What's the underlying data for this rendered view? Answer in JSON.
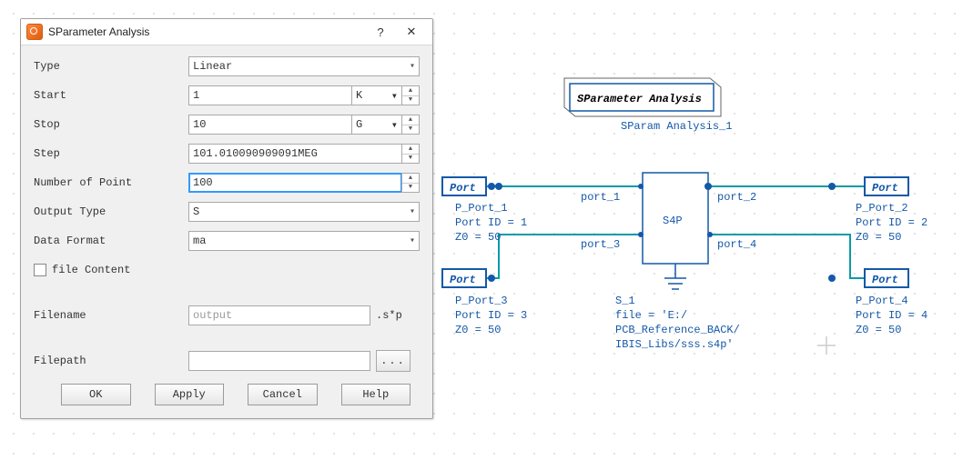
{
  "dialog": {
    "title": "SParameter Analysis",
    "help": "?",
    "close": "✕",
    "rows": {
      "type": {
        "label": "Type",
        "value": "Linear"
      },
      "start": {
        "label": "Start",
        "value": "1",
        "unit": "K"
      },
      "stop": {
        "label": "Stop",
        "value": "10",
        "unit": "G"
      },
      "step": {
        "label": "Step",
        "value": "101.010090909091MEG"
      },
      "npoint": {
        "label": "Number of Point",
        "value": "100"
      },
      "outtype": {
        "label": "Output Type",
        "value": "S"
      },
      "dformat": {
        "label": "Data Format",
        "value": "ma"
      },
      "filecontent": {
        "label": "file Content"
      },
      "filename": {
        "label": "Filename",
        "placeholder": "output",
        "suffix": ".s*p"
      },
      "filepath": {
        "label": "Filepath",
        "browse": "..."
      }
    },
    "buttons": {
      "ok": "OK",
      "apply": "Apply",
      "cancel": "Cancel",
      "help": "Help"
    }
  },
  "schematic": {
    "titleblock": {
      "title": "SParameter Analysis",
      "instance": "SParam Analysis_1"
    },
    "s4p": {
      "name": "S4P",
      "pins": {
        "p1": "port_1",
        "p2": "port_2",
        "p3": "port_3",
        "p4": "port_4"
      }
    },
    "s1": {
      "name": "S_1",
      "file1": "file = 'E:/",
      "file2": "PCB_Reference_BACK/",
      "file3": "IBIS_Libs/sss.s4p'"
    },
    "port_label": "Port",
    "ports": {
      "p1": {
        "name": "P_Port_1",
        "id": "Port ID = 1",
        "z": "Z0 = 50"
      },
      "p2": {
        "name": "P_Port_2",
        "id": "Port ID = 2",
        "z": "Z0 = 50"
      },
      "p3": {
        "name": "P_Port_3",
        "id": "Port ID = 3",
        "z": "Z0 = 50"
      },
      "p4": {
        "name": "P_Port_4",
        "id": "Port ID = 4",
        "z": "Z0 = 50"
      }
    }
  }
}
